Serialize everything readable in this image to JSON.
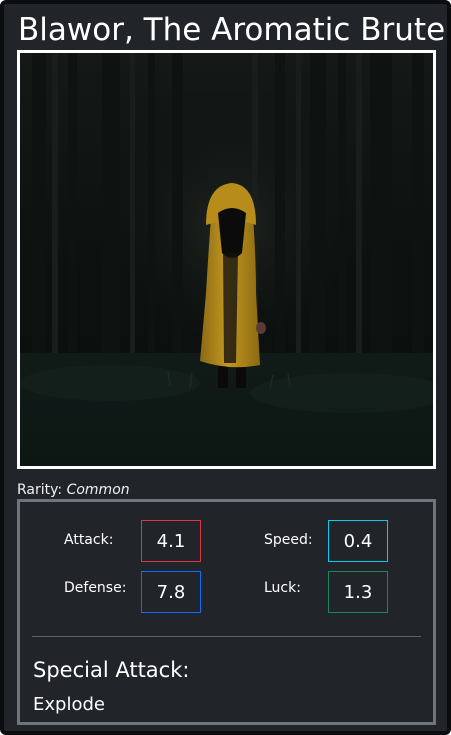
{
  "card": {
    "name": "Blawor, The Aromatic Brute",
    "image_icon": "hooded-figure-in-dark-forest",
    "rarity_label": "Rarity:",
    "rarity_value": "Common",
    "stats": {
      "attack": {
        "label": "Attack:",
        "value": "4.1",
        "color": "#dc3545"
      },
      "speed": {
        "label": "Speed:",
        "value": "0.4",
        "color": "#0dcaf0"
      },
      "defense": {
        "label": "Defense:",
        "value": "7.8",
        "color": "#0d6efd"
      },
      "luck": {
        "label": "Luck:",
        "value": "1.3",
        "color": "#198754"
      }
    },
    "special_attack_title": "Special Attack:",
    "special_attack_value": "Explode"
  },
  "colors": {
    "card_bg": "#212529",
    "stats_border": "#6c757d"
  }
}
